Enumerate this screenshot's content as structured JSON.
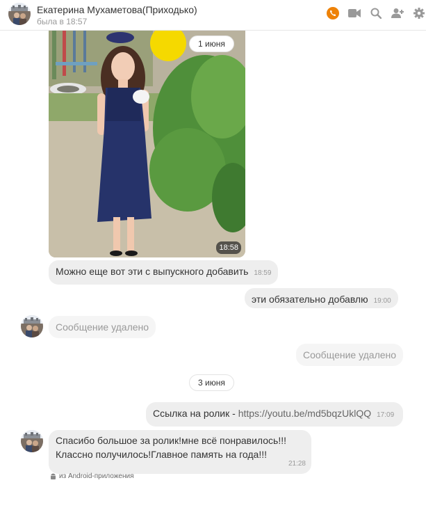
{
  "header": {
    "contact_name": "Екатерина Мухаметова(Приходько)",
    "status": "была в 18:57",
    "icons": [
      "phone-icon",
      "video-icon",
      "search-icon",
      "add-user-icon",
      "gear-icon"
    ],
    "accent_color": "#ee8208"
  },
  "messages": {
    "date1": "1 июня",
    "photo_time": "18:58",
    "msg1_text": "Можно еще вот эти с выпускного добавить",
    "msg1_time": "18:59",
    "msg2_text": "эти обязательно добавлю",
    "msg2_time": "19:00",
    "deleted_in": "Сообщение удалено",
    "deleted_out": "Сообщение удалено",
    "date2": "3 июня",
    "msg3_prefix": "Ссылка на ролик - ",
    "msg3_link": "https://youtu.be/md5bqzUklQQ",
    "msg3_time": "17:09",
    "msg4_text": "Спасибо большое за ролик!мне всё понравилось!!!Классно получилось!Главное память на года!!!",
    "msg4_time": "21:28"
  },
  "footer": {
    "source": "из Android-приложения",
    "icon": "android-icon"
  }
}
